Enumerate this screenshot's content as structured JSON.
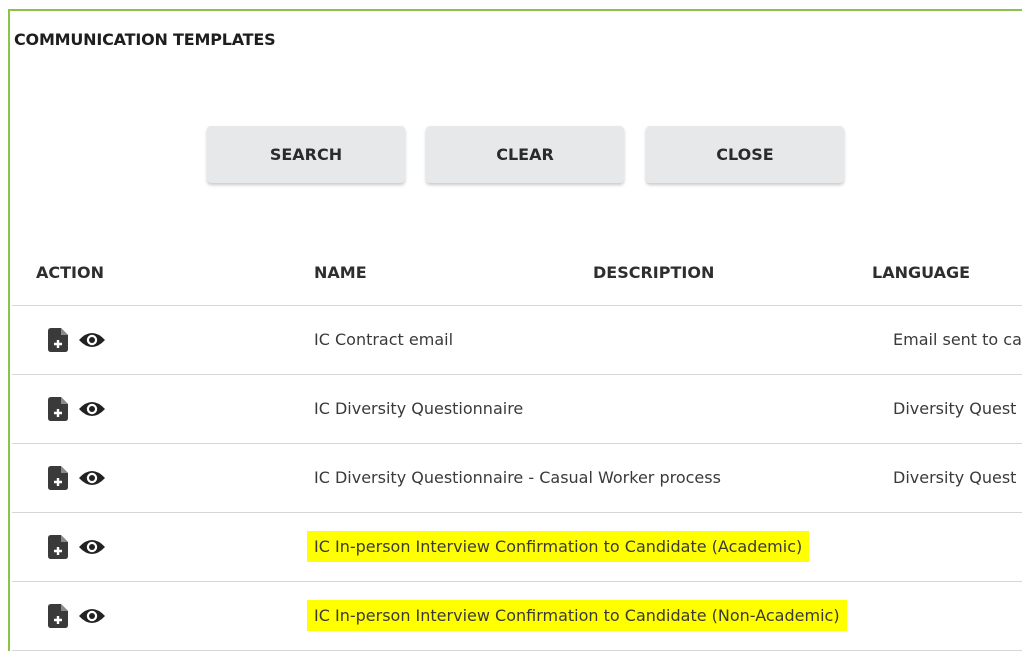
{
  "page": {
    "title": "COMMUNICATION TEMPLATES",
    "accent_color": "#8bc34a",
    "highlight_color": "#ffff00"
  },
  "toolbar": {
    "search_label": "SEARCH",
    "clear_label": "CLEAR",
    "close_label": "CLOSE"
  },
  "table": {
    "columns": {
      "action": "ACTION",
      "name": "NAME",
      "description": "DESCRIPTION",
      "language": "LANGUAGE"
    },
    "action_icons": [
      "add-document-icon",
      "view-eye-icon"
    ],
    "rows": [
      {
        "name": "IC Contract email",
        "description": "Email sent to ca",
        "highlighted": false
      },
      {
        "name": "IC Diversity Questionnaire",
        "description": "Diversity Quest",
        "highlighted": false
      },
      {
        "name": "IC Diversity Questionnaire - Casual Worker process",
        "description": "Diversity Quest",
        "highlighted": false
      },
      {
        "name": "IC In-person Interview Confirmation to Candidate (Academic)",
        "description": "",
        "highlighted": true
      },
      {
        "name": "IC In-person Interview Confirmation to Candidate (Non-Academic)",
        "description": "",
        "highlighted": true
      }
    ]
  }
}
